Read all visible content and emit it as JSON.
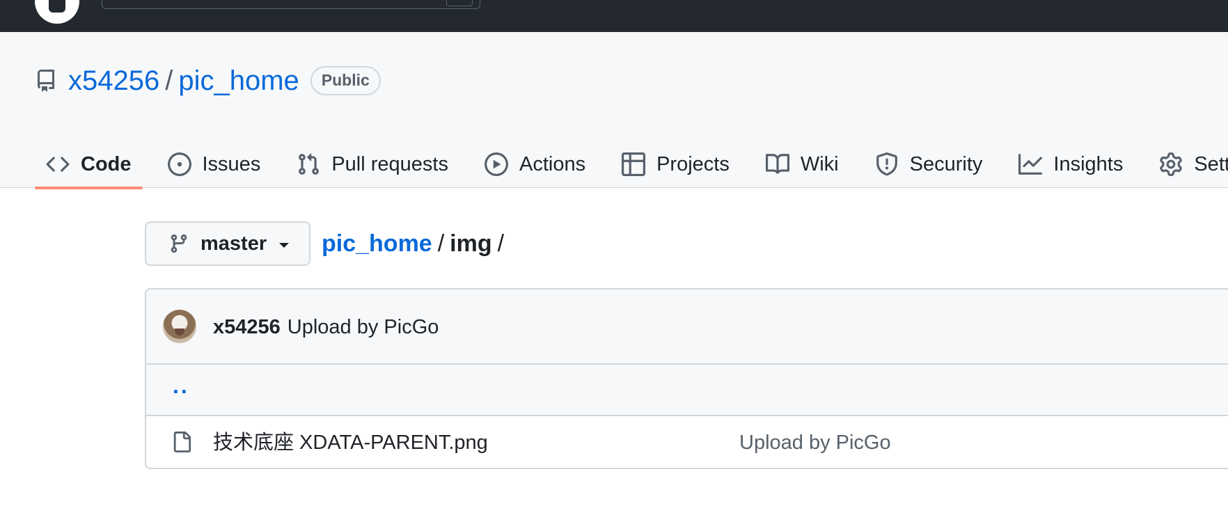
{
  "repo": {
    "owner": "x54256",
    "separator": "/",
    "name": "pic_home",
    "visibility": "Public"
  },
  "tabs": [
    {
      "label": "Code",
      "icon": "code-icon",
      "active": true
    },
    {
      "label": "Issues",
      "icon": "issue-icon"
    },
    {
      "label": "Pull requests",
      "icon": "pull-request-icon"
    },
    {
      "label": "Actions",
      "icon": "play-icon"
    },
    {
      "label": "Projects",
      "icon": "table-icon"
    },
    {
      "label": "Wiki",
      "icon": "book-icon"
    },
    {
      "label": "Security",
      "icon": "shield-icon"
    },
    {
      "label": "Insights",
      "icon": "graph-icon"
    },
    {
      "label": "Setti",
      "icon": "gear-icon"
    }
  ],
  "branch": {
    "name": "master"
  },
  "breadcrumb": {
    "root": "pic_home",
    "sep1": "/",
    "current": "img",
    "sep2": "/"
  },
  "commit": {
    "author": "x54256",
    "message": "Upload by PicGo"
  },
  "files": {
    "parent_link": "..",
    "items": [
      {
        "name": "技术底座 XDATA-PARENT.png",
        "commit_message": "Upload by PicGo"
      }
    ]
  },
  "colors": {
    "header_bg": "#24292f",
    "link": "#0969da",
    "active_tab_underline": "#fd8c73",
    "muted": "#57606a"
  }
}
